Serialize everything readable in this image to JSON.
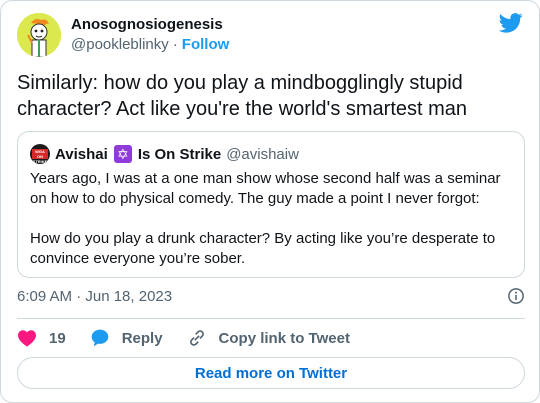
{
  "author": {
    "display_name": "Anosognosiogenesis",
    "handle": "@pookleblinky",
    "separator": "·",
    "follow_label": "Follow"
  },
  "tweet": {
    "text": "Similarly: how do you play a mindbogglingly stupid character? Act like you're the world's smartest man",
    "timestamp": "6:09 AM · Jun 18, 2023"
  },
  "quote": {
    "avatar_text": "WGA ON STRIKE",
    "name": "Avishai",
    "star_glyph": "✡",
    "name_suffix": "Is On Strike",
    "handle": "@avishaiw",
    "body": "Years ago, I was at a one man show whose second half was a seminar on how to do physical comedy. The guy made a point I never forgot:\n\nHow do you play a drunk character? By acting like you’re desperate to convince everyone you’re sober."
  },
  "actions": {
    "like_count": "19",
    "reply_label": "Reply",
    "copy_label": "Copy link to Tweet"
  },
  "read_more_label": "Read more on Twitter",
  "colors": {
    "brand_blue": "#1d9bf0",
    "link_blue": "#006fd6",
    "like_red": "#f91880",
    "muted": "#536471",
    "border": "#cfd9de"
  },
  "icons": [
    "twitter-bird-icon",
    "info-icon",
    "heart-icon",
    "reply-bubble-icon",
    "link-icon"
  ]
}
